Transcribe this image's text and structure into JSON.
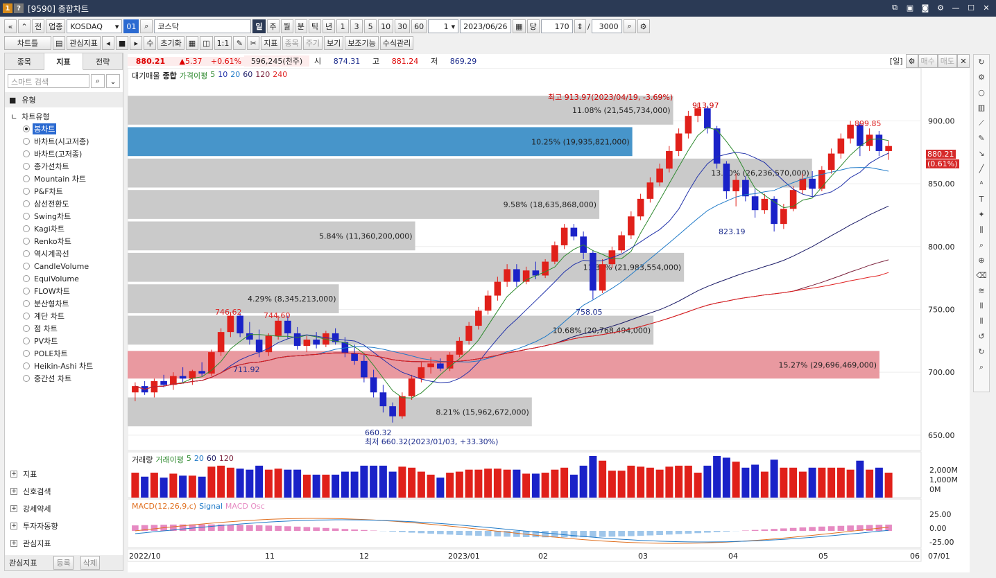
{
  "window": {
    "title": "[9590] 종합차트",
    "badge1": "1",
    "badge2": "?"
  },
  "toolbar1": {
    "btn_all": "전",
    "btn_sector": "업종",
    "market": "KOSDAQ",
    "code_tag": "01",
    "name": "코스닥",
    "periods": [
      "일",
      "주",
      "월",
      "분",
      "틱",
      "년"
    ],
    "intervals": [
      "1",
      "3",
      "5",
      "10",
      "30",
      "60"
    ],
    "count_box": "1",
    "date": "2023/06/26",
    "day_label": "당",
    "count": "170",
    "total": "3000"
  },
  "toolbar2": {
    "chart_menu": "차트틀",
    "watch": "관심지표",
    "su": "수",
    "reset": "초기화",
    "ratio": "1:1",
    "indicator": "지표",
    "item": "종목",
    "period": "주기",
    "view": "보기",
    "aux": "보조기능",
    "formula": "수식관리"
  },
  "left": {
    "tabs": [
      "종목",
      "지표",
      "전략"
    ],
    "search_placeholder": "스마트 검색",
    "group": "유형",
    "tree_root": "차트유형",
    "items": [
      "봉차트",
      "바차트(시고저종)",
      "바차트(고저종)",
      "종가선차트",
      "Mountain 차트",
      "P&F차트",
      "삼선전환도",
      "Swing차트",
      "Kagi차트",
      "Renko차트",
      "역시계곡선",
      "CandleVolume",
      "EquiVolume",
      "FLOW차트",
      "분산형차트",
      "계단 차트",
      "점 차트",
      "PV차트",
      "POLE차트",
      "Heikin-Ashi 차트",
      "중간선 차트"
    ],
    "bottom_groups": [
      "지표",
      "신호검색",
      "강세약세",
      "투자자동향",
      "관심지표"
    ],
    "watch_label": "관심지표",
    "register": "등록",
    "delete": "삭제"
  },
  "quote": {
    "price": "880.21",
    "change": "▲5.37",
    "pct": "+0.61%",
    "volume": "596,245(천주)",
    "open_label": "시",
    "open": "874.31",
    "high_label": "고",
    "high": "881.24",
    "low_label": "저",
    "low": "869.29",
    "period_tag": "[일]",
    "buy": "매수",
    "sell": "매도"
  },
  "main_legend": {
    "items": [
      "대기매물",
      "종합",
      "가격이평",
      "5",
      "10",
      "20",
      "60",
      "120",
      "240"
    ]
  },
  "annotations": {
    "high": "최고 913.97(2023/04/19, -3.69%)",
    "high_val": "913.97",
    "low": "최저 660.32(2023/01/03, +33.30%)",
    "low_val": "660.32",
    "p1": "746.62",
    "p2": "744.60",
    "p3": "711.92",
    "p4": "758.05",
    "p5": "823.19",
    "p6": "899.85",
    "last_price": "880.21",
    "last_pct": "(0.61%)"
  },
  "vol_legend": {
    "items": [
      "거래량",
      "거래이평",
      "5",
      "20",
      "60",
      "120"
    ]
  },
  "vol_ticks": [
    "2,000M",
    "1,000M",
    "0M"
  ],
  "macd_legend": {
    "items": [
      "MACD(12,26,9,c)",
      "Signal",
      "MACD Osc"
    ]
  },
  "macd_ticks": [
    "25.00",
    "0.00",
    "-25.00"
  ],
  "chart_data": {
    "type": "candlestick",
    "price_ticks": [
      "900.00",
      "850.00",
      "800.00",
      "750.00",
      "700.00",
      "650.00"
    ],
    "ylim": [
      640,
      930
    ],
    "x_labels": [
      "2022/10",
      "11",
      "12",
      "2023/01",
      "02",
      "03",
      "04",
      "05",
      "06",
      "07/01"
    ],
    "volume_profile": [
      {
        "label": "15.27% (29,696,469,000)",
        "low": 695,
        "high": 717,
        "pct": 15.27
      },
      {
        "label": "8.21% (15,962,672,000)",
        "low": 657,
        "high": 680,
        "pct": 8.21
      },
      {
        "label": "10.68% (20,768,494,000)",
        "low": 722,
        "high": 745,
        "pct": 10.68
      },
      {
        "label": "4.29% (8,345,213,000)",
        "low": 747,
        "high": 770,
        "pct": 4.29
      },
      {
        "label": "11.30% (21,983,554,000)",
        "low": 772,
        "high": 795,
        "pct": 11.3
      },
      {
        "label": "5.84% (11,360,200,000)",
        "low": 797,
        "high": 820,
        "pct": 5.84
      },
      {
        "label": "9.58% (18,635,868,000)",
        "low": 822,
        "high": 845,
        "pct": 9.58
      },
      {
        "label": "13.90% (26,236,570,000)",
        "low": 847,
        "high": 870,
        "pct": 13.9
      },
      {
        "label": "10.25% (19,935,821,000)",
        "low": 872,
        "high": 895,
        "pct": 10.25
      },
      {
        "label": "11.08% (21,545,734,000)",
        "low": 897,
        "high": 920,
        "pct": 11.08
      }
    ],
    "candles": [
      {
        "o": 684,
        "h": 692,
        "l": 677,
        "c": 689
      },
      {
        "o": 689,
        "h": 693,
        "l": 682,
        "c": 684
      },
      {
        "o": 684,
        "h": 695,
        "l": 680,
        "c": 693
      },
      {
        "o": 693,
        "h": 698,
        "l": 688,
        "c": 690
      },
      {
        "o": 690,
        "h": 700,
        "l": 686,
        "c": 697
      },
      {
        "o": 697,
        "h": 704,
        "l": 692,
        "c": 695
      },
      {
        "o": 695,
        "h": 702,
        "l": 690,
        "c": 701
      },
      {
        "o": 701,
        "h": 708,
        "l": 697,
        "c": 699
      },
      {
        "o": 699,
        "h": 718,
        "l": 697,
        "c": 716
      },
      {
        "o": 716,
        "h": 735,
        "l": 713,
        "c": 732
      },
      {
        "o": 732,
        "h": 748,
        "l": 728,
        "c": 745
      },
      {
        "o": 745,
        "h": 747,
        "l": 728,
        "c": 731
      },
      {
        "o": 731,
        "h": 740,
        "l": 722,
        "c": 726
      },
      {
        "o": 726,
        "h": 734,
        "l": 712,
        "c": 716
      },
      {
        "o": 716,
        "h": 731,
        "l": 713,
        "c": 729
      },
      {
        "o": 729,
        "h": 745,
        "l": 726,
        "c": 741
      },
      {
        "o": 741,
        "h": 745,
        "l": 727,
        "c": 731
      },
      {
        "o": 731,
        "h": 736,
        "l": 718,
        "c": 721
      },
      {
        "o": 721,
        "h": 729,
        "l": 716,
        "c": 726
      },
      {
        "o": 726,
        "h": 732,
        "l": 719,
        "c": 722
      },
      {
        "o": 722,
        "h": 733,
        "l": 720,
        "c": 731
      },
      {
        "o": 731,
        "h": 735,
        "l": 722,
        "c": 724
      },
      {
        "o": 724,
        "h": 728,
        "l": 712,
        "c": 715
      },
      {
        "o": 715,
        "h": 722,
        "l": 706,
        "c": 709
      },
      {
        "o": 709,
        "h": 714,
        "l": 692,
        "c": 696
      },
      {
        "o": 696,
        "h": 702,
        "l": 680,
        "c": 684
      },
      {
        "o": 684,
        "h": 690,
        "l": 668,
        "c": 673
      },
      {
        "o": 673,
        "h": 676,
        "l": 660,
        "c": 665
      },
      {
        "o": 665,
        "h": 684,
        "l": 663,
        "c": 681
      },
      {
        "o": 681,
        "h": 698,
        "l": 678,
        "c": 695
      },
      {
        "o": 695,
        "h": 708,
        "l": 692,
        "c": 704
      },
      {
        "o": 704,
        "h": 712,
        "l": 699,
        "c": 707
      },
      {
        "o": 707,
        "h": 711,
        "l": 701,
        "c": 703
      },
      {
        "o": 703,
        "h": 716,
        "l": 701,
        "c": 714
      },
      {
        "o": 714,
        "h": 728,
        "l": 712,
        "c": 725
      },
      {
        "o": 725,
        "h": 740,
        "l": 722,
        "c": 737
      },
      {
        "o": 737,
        "h": 752,
        "l": 734,
        "c": 749
      },
      {
        "o": 749,
        "h": 765,
        "l": 746,
        "c": 761
      },
      {
        "o": 761,
        "h": 776,
        "l": 757,
        "c": 772
      },
      {
        "o": 772,
        "h": 786,
        "l": 768,
        "c": 782
      },
      {
        "o": 782,
        "h": 786,
        "l": 768,
        "c": 772
      },
      {
        "o": 772,
        "h": 784,
        "l": 770,
        "c": 781
      },
      {
        "o": 781,
        "h": 788,
        "l": 774,
        "c": 777
      },
      {
        "o": 777,
        "h": 790,
        "l": 775,
        "c": 788
      },
      {
        "o": 788,
        "h": 804,
        "l": 786,
        "c": 801
      },
      {
        "o": 801,
        "h": 818,
        "l": 798,
        "c": 815
      },
      {
        "o": 815,
        "h": 818,
        "l": 805,
        "c": 808
      },
      {
        "o": 808,
        "h": 812,
        "l": 790,
        "c": 795
      },
      {
        "o": 795,
        "h": 797,
        "l": 758,
        "c": 765
      },
      {
        "o": 765,
        "h": 790,
        "l": 763,
        "c": 786
      },
      {
        "o": 786,
        "h": 800,
        "l": 783,
        "c": 797
      },
      {
        "o": 797,
        "h": 812,
        "l": 795,
        "c": 809
      },
      {
        "o": 809,
        "h": 828,
        "l": 806,
        "c": 824
      },
      {
        "o": 824,
        "h": 842,
        "l": 821,
        "c": 838
      },
      {
        "o": 838,
        "h": 855,
        "l": 835,
        "c": 851
      },
      {
        "o": 851,
        "h": 866,
        "l": 848,
        "c": 862
      },
      {
        "o": 862,
        "h": 880,
        "l": 859,
        "c": 876
      },
      {
        "o": 876,
        "h": 894,
        "l": 872,
        "c": 890
      },
      {
        "o": 890,
        "h": 908,
        "l": 886,
        "c": 904
      },
      {
        "o": 904,
        "h": 914,
        "l": 899,
        "c": 910
      },
      {
        "o": 910,
        "h": 912,
        "l": 890,
        "c": 894
      },
      {
        "o": 894,
        "h": 896,
        "l": 862,
        "c": 866
      },
      {
        "o": 866,
        "h": 868,
        "l": 838,
        "c": 844
      },
      {
        "o": 844,
        "h": 858,
        "l": 832,
        "c": 853
      },
      {
        "o": 853,
        "h": 856,
        "l": 836,
        "c": 840
      },
      {
        "o": 840,
        "h": 846,
        "l": 823,
        "c": 829
      },
      {
        "o": 829,
        "h": 842,
        "l": 826,
        "c": 838
      },
      {
        "o": 838,
        "h": 840,
        "l": 812,
        "c": 818
      },
      {
        "o": 818,
        "h": 834,
        "l": 814,
        "c": 830
      },
      {
        "o": 830,
        "h": 848,
        "l": 828,
        "c": 845
      },
      {
        "o": 845,
        "h": 858,
        "l": 842,
        "c": 854
      },
      {
        "o": 854,
        "h": 860,
        "l": 840,
        "c": 846
      },
      {
        "o": 846,
        "h": 864,
        "l": 844,
        "c": 861
      },
      {
        "o": 861,
        "h": 878,
        "l": 858,
        "c": 874
      },
      {
        "o": 874,
        "h": 890,
        "l": 870,
        "c": 886
      },
      {
        "o": 886,
        "h": 900,
        "l": 882,
        "c": 897
      },
      {
        "o": 897,
        "h": 899,
        "l": 872,
        "c": 880
      },
      {
        "o": 880,
        "h": 894,
        "l": 876,
        "c": 889
      },
      {
        "o": 889,
        "h": 892,
        "l": 872,
        "c": 876
      },
      {
        "o": 876,
        "h": 884,
        "l": 869,
        "c": 880
      }
    ],
    "volume_max": 2500,
    "macd_ylim": [
      -30,
      30
    ]
  }
}
